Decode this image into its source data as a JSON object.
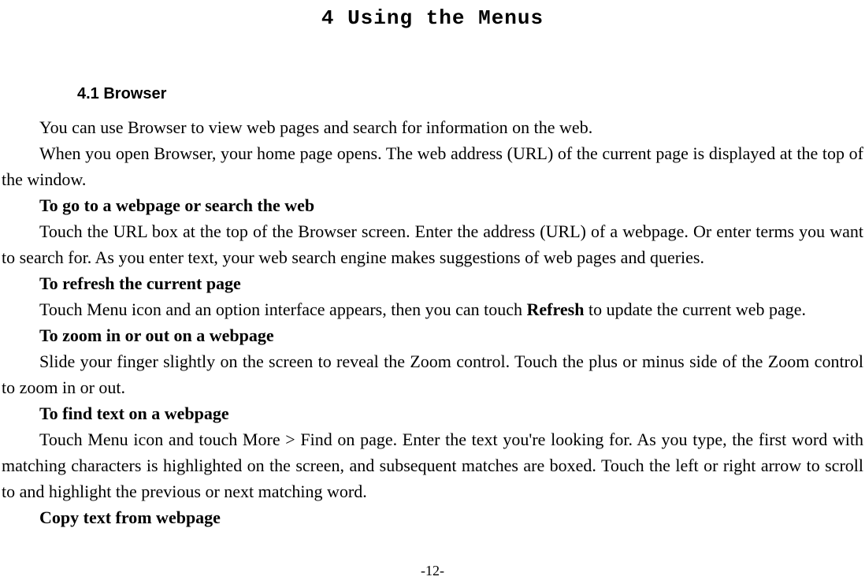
{
  "chapter_title": "4 Using the Menus",
  "subsection_title": "4.1    Browser",
  "para1": "You can use Browser to view web pages and search for information on the web.",
  "para2": "When you open Browser, your home page opens. The web address (URL) of the current page is displayed at the top of the window.",
  "heading_goto": "To go to a webpage or search the web",
  "para_goto": "Touch the URL box at the top of the Browser screen. Enter the address (URL) of a webpage. Or enter terms you want to search for. As you enter text, your web search engine makes suggestions of web pages and queries.",
  "heading_refresh": "To refresh the current page",
  "para_refresh_a": "Touch Menu icon and an option interface appears, then you can touch ",
  "para_refresh_bold": "Refresh",
  "para_refresh_b": " to update the current web page.",
  "heading_zoom": "To zoom in or out on a webpage",
  "para_zoom": "Slide your finger slightly on the screen to reveal the Zoom control. Touch the plus or minus side of the Zoom control to zoom in or out.",
  "heading_find": "To find text on a webpage",
  "para_find": "Touch Menu icon and touch More > Find on page. Enter the text you're looking for. As you type, the first word with matching characters is highlighted on the screen, and subsequent matches are boxed. Touch the left or right arrow to scroll to and highlight the previous or next matching word.",
  "heading_copy": "Copy text from webpage",
  "page_number": "-12-"
}
